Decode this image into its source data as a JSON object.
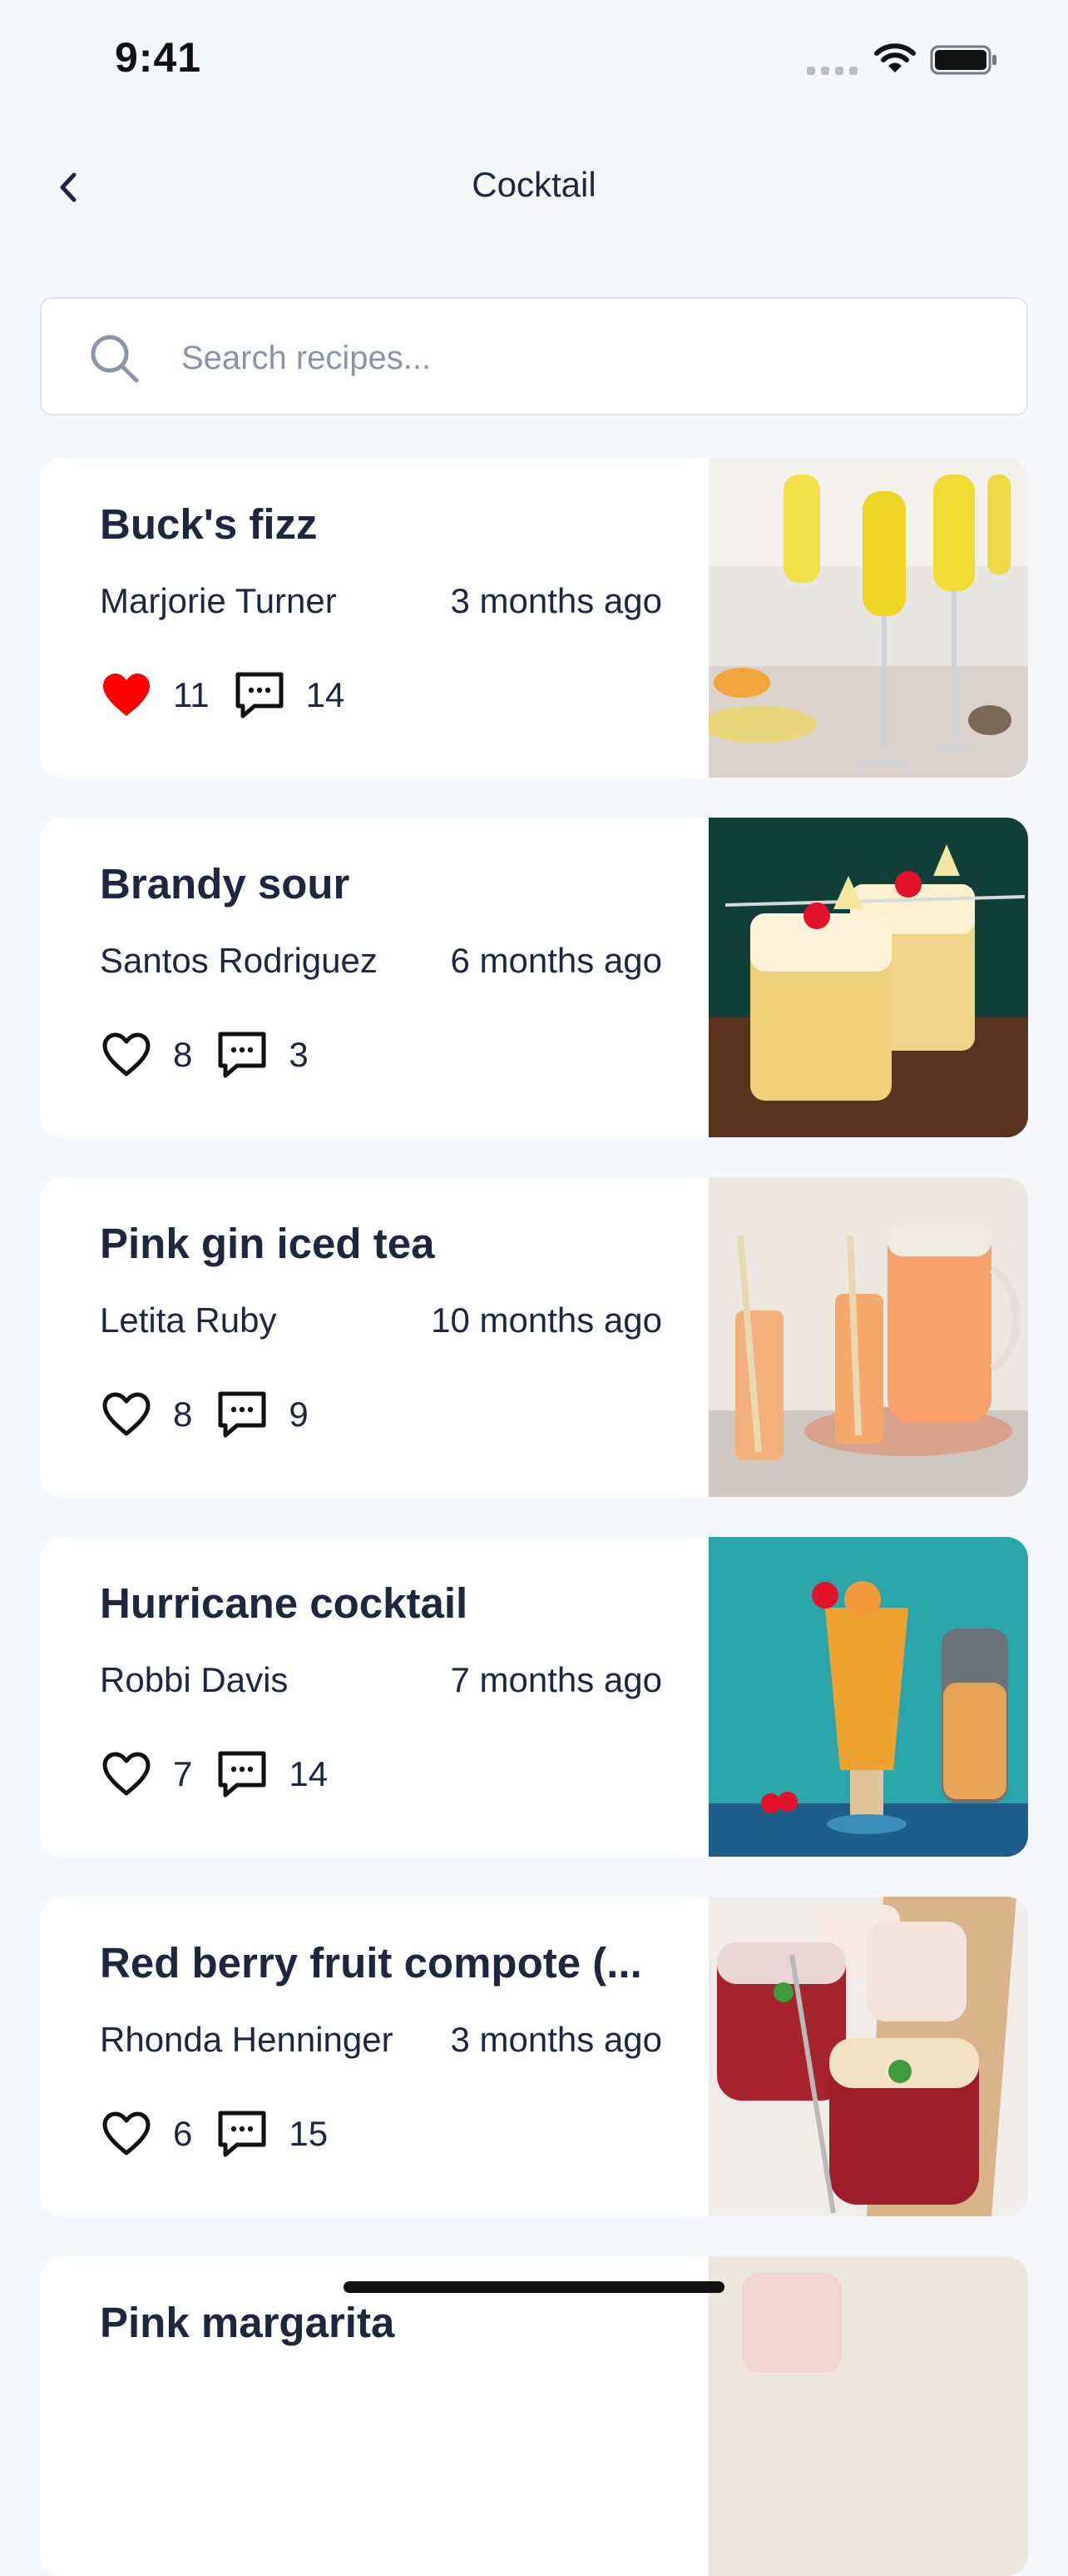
{
  "status_bar": {
    "time": "9:41"
  },
  "header": {
    "title": "Cocktail"
  },
  "search": {
    "placeholder": "Search recipes..."
  },
  "recipes": [
    {
      "title": "Buck's fizz",
      "author": "Marjorie Turner",
      "time": "3 months ago",
      "likes": "11",
      "comments": "14",
      "liked": true,
      "image": "mimosa-flutes-photo"
    },
    {
      "title": "Brandy sour",
      "author": "Santos Rodriguez",
      "time": "6 months ago",
      "likes": "8",
      "comments": "3",
      "liked": false,
      "image": "brandy-sour-glasses-photo"
    },
    {
      "title": "Pink gin iced tea",
      "author": "Letita Ruby",
      "time": "10 months ago",
      "likes": "8",
      "comments": "9",
      "liked": false,
      "image": "iced-tea-pitcher-photo"
    },
    {
      "title": "Hurricane cocktail",
      "author": "Robbi Davis",
      "time": "7 months ago",
      "likes": "7",
      "comments": "14",
      "liked": false,
      "image": "hurricane-glass-photo"
    },
    {
      "title": "Red berry fruit compote (...",
      "author": "Rhonda Henninger",
      "time": "3 months ago",
      "likes": "6",
      "comments": "15",
      "liked": false,
      "image": "berry-compote-glasses-photo"
    },
    {
      "title": "Pink margarita",
      "image": "pink-drink-photo"
    }
  ],
  "colors": {
    "background": "#f6f7fb",
    "text": "#1f2740",
    "liked_heart": "#ff0000",
    "placeholder": "#8b93a6"
  }
}
